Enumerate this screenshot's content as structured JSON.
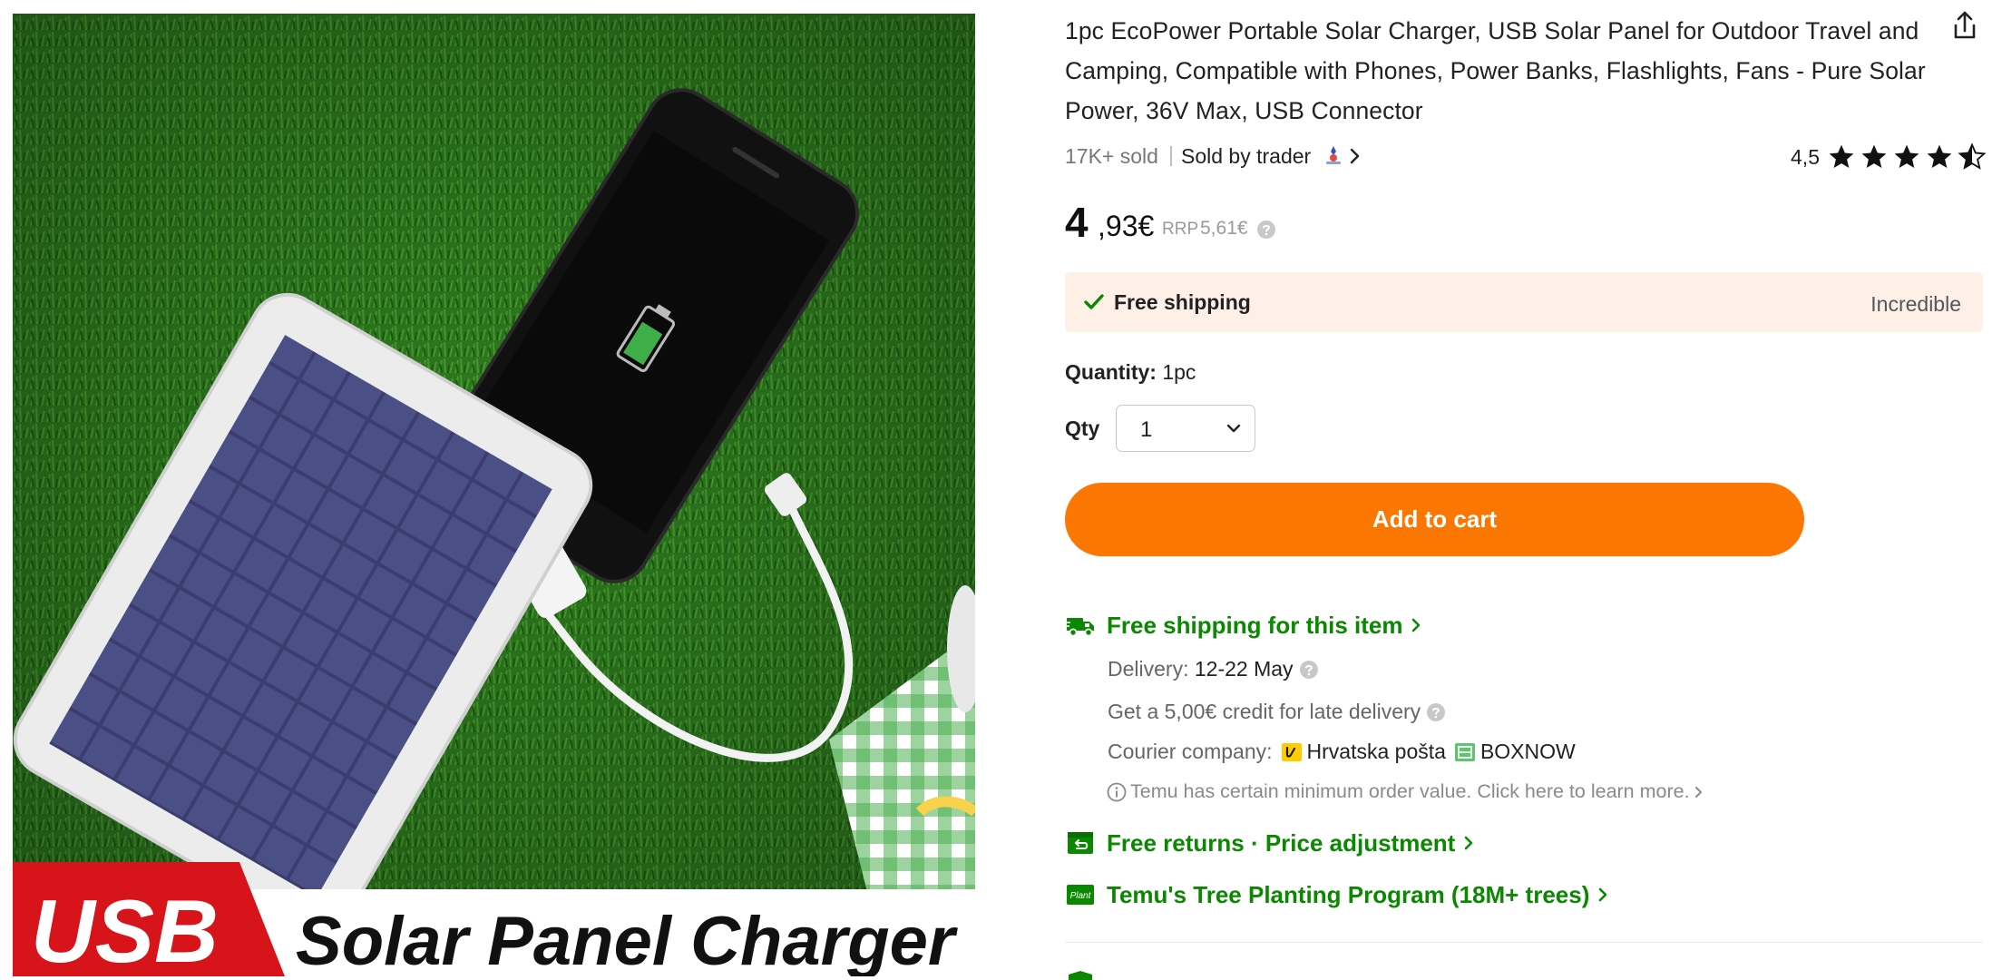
{
  "product": {
    "image_banner_left": "USB",
    "image_banner_right": "Solar Panel Charger",
    "title": "1pc EcoPower Portable Solar Charger, USB Solar Panel for Outdoor Travel and Camping, Compatible with Phones, Power Banks, Flashlights, Fans - Pure Solar Power, 36V Max, USB Connector",
    "sold": "17K+ sold",
    "separator": "|",
    "seller": "Sold by trader",
    "rating_value": "4,5",
    "rating_stars": 4.5
  },
  "price": {
    "integer": "4",
    "decimal": ",93€",
    "rrp_label": "RRP",
    "rrp_value": "5,61€"
  },
  "shipping_banner": {
    "label": "Free shipping",
    "tag": "Incredible"
  },
  "quantity": {
    "label": "Quantity:",
    "value": "1pc",
    "qty_label": "Qty",
    "qty_selected": "1"
  },
  "cart": {
    "add_label": "Add to cart"
  },
  "shipping": {
    "title": "Free shipping for this item",
    "delivery_label": "Delivery:",
    "delivery_value": "12-22 May",
    "credit": "Get a 5,00€ credit for late delivery",
    "courier_label": "Courier company:",
    "courier_1": "Hrvatska pošta",
    "courier_2": "BOXNOW",
    "notice": "Temu has certain minimum order value. Click here to learn more."
  },
  "returns": {
    "label": "Free returns · Price adjustment"
  },
  "tree": {
    "icon_text": "Plant",
    "label": "Temu's Tree Planting Program (18M+ trees)"
  },
  "colors": {
    "accent": "#fb7701",
    "green": "#0a8800",
    "banner_bg": "#fef0e6"
  },
  "icons": {
    "share": "share-icon",
    "truck": "truck-icon",
    "returns": "returns-icon",
    "plant": "plant-icon",
    "check": "check-icon",
    "help": "help-icon",
    "info": "info-icon"
  }
}
